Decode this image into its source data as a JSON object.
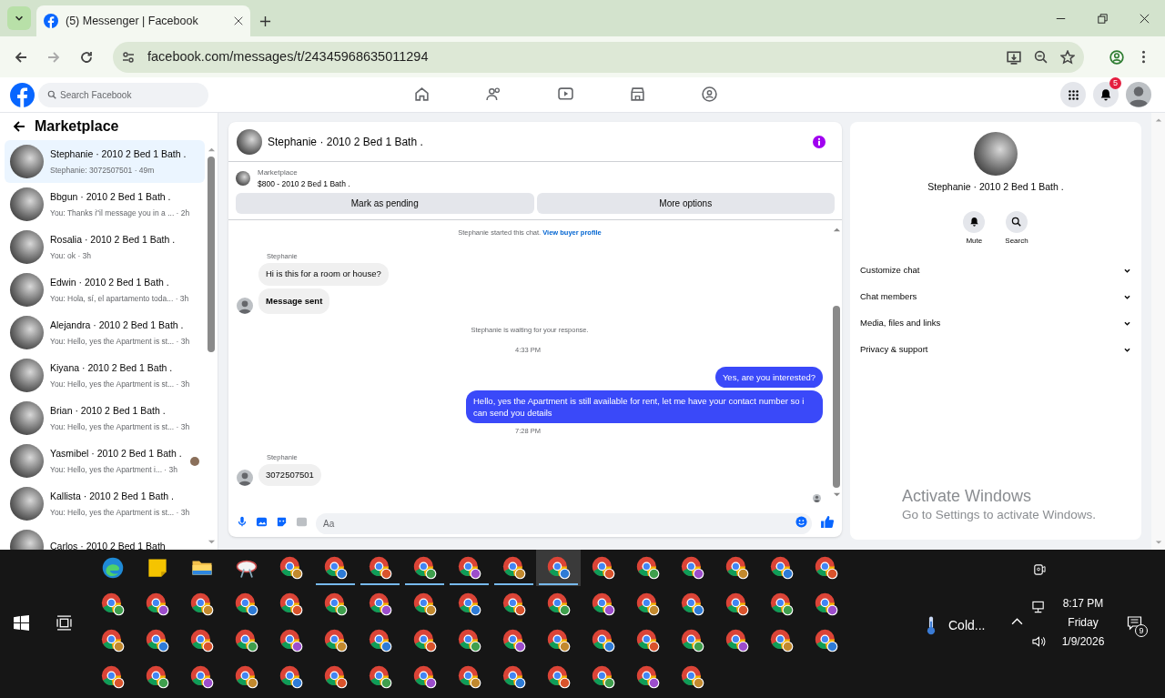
{
  "browser": {
    "tab": {
      "title": "(5) Messenger | Facebook",
      "selected": true
    },
    "url": "facebook.com/messages/t/24345968635011294"
  },
  "facebook": {
    "search": {
      "placeholder": "Search Facebook"
    },
    "nav": [
      {
        "kind": "home",
        "selected": false
      },
      {
        "kind": "friends",
        "selected": false
      },
      {
        "kind": "video",
        "selected": false
      },
      {
        "kind": "marketplace",
        "selected": false
      },
      {
        "kind": "groups",
        "selected": false
      }
    ],
    "notification_count": "5"
  },
  "sidebar": {
    "title": "Marketplace",
    "conversations": [
      {
        "title": "Stephanie · 2010 2 Bed 1 Bath .",
        "preview": "Stephanie: 3072507501 · 49m",
        "selected": true,
        "seen": false
      },
      {
        "title": "Bbgun · 2010 2 Bed 1 Bath .",
        "preview": "You: Thanks i\"il message you in a ... · 2h",
        "selected": false,
        "seen": false
      },
      {
        "title": "Rosalia · 2010 2 Bed 1 Bath .",
        "preview": "You: ok · 3h",
        "selected": false,
        "seen": false
      },
      {
        "title": "Edwin · 2010 2 Bed 1 Bath .",
        "preview": "You: Hola, sí, el apartamento toda... · 3h",
        "selected": false,
        "seen": false
      },
      {
        "title": "Alejandra · 2010 2 Bed 1 Bath .",
        "preview": "You: Hello, yes the Apartment is st... · 3h",
        "selected": false,
        "seen": false
      },
      {
        "title": "Kiyana · 2010 2 Bed 1 Bath .",
        "preview": "You: Hello, yes the Apartment is st... · 3h",
        "selected": false,
        "seen": false
      },
      {
        "title": "Brian · 2010 2 Bed 1 Bath .",
        "preview": "You: Hello, yes the Apartment is st... · 3h",
        "selected": false,
        "seen": false
      },
      {
        "title": "Yasmibel · 2010 2 Bed 1 Bath .",
        "preview": "You: Hello, yes the Apartment i... · 3h",
        "selected": false,
        "seen": true
      },
      {
        "title": "Kallista · 2010 2 Bed 1 Bath .",
        "preview": "You: Hello, yes the Apartment is st... · 3h",
        "selected": false,
        "seen": false
      },
      {
        "title": "Carlos · 2010 2 Bed 1 Bath",
        "selected": false,
        "seen": false
      }
    ]
  },
  "chat": {
    "title": "Stephanie · 2010 2 Bed 1 Bath .",
    "listing": {
      "label": "Marketplace",
      "title": "$800 - 2010 2 Bed 1 Bath ."
    },
    "buttons": [
      "Mark as pending",
      "More options"
    ],
    "messages": [
      {
        "kind": "notice",
        "text": "Stephanie started this chat.",
        "link": "View buyer profile"
      },
      {
        "kind": "sender",
        "text": "Stephanie"
      },
      {
        "kind": "incoming",
        "text": "Hi is this for a room or house?",
        "avatar": false,
        "bold": false
      },
      {
        "kind": "incoming",
        "text": "Message sent",
        "avatar": true,
        "bold": true
      },
      {
        "kind": "notice",
        "text": "Stephanie is waiting for your response."
      },
      {
        "kind": "time",
        "text": "4:33 PM"
      },
      {
        "kind": "outgoing",
        "text": "Yes, are you interested?"
      },
      {
        "kind": "outgoing",
        "text": "Hello, yes the Apartment is still available for rent, let me have your contact number so i can send you details"
      },
      {
        "kind": "time",
        "text": "7:28 PM"
      },
      {
        "kind": "sender",
        "text": "Stephanie"
      },
      {
        "kind": "incoming",
        "text": "3072507501",
        "avatar": true,
        "bold": false
      }
    ],
    "composer": {
      "placeholder": "Aa"
    }
  },
  "details": {
    "title": "Stephanie · 2010 2 Bed 1 Bath .",
    "actions": [
      {
        "kind": "bell",
        "label": "Mute"
      },
      {
        "kind": "search",
        "label": "Search"
      }
    ],
    "sections": [
      {
        "label": "Customize chat",
        "expanded": false
      },
      {
        "label": "Chat members",
        "expanded": false
      },
      {
        "label": "Media, files and links",
        "expanded": false
      },
      {
        "label": "Privacy & support",
        "expanded": false
      }
    ]
  },
  "activation_notice": {
    "title": "Activate Windows",
    "text": "Go to Settings to activate Windows."
  },
  "taskbar": {
    "apps": [
      {
        "kind": "edge",
        "running": false,
        "active": false
      },
      {
        "kind": "notes",
        "running": false,
        "active": false
      },
      {
        "kind": "folder",
        "running": false,
        "active": false
      },
      {
        "kind": "snip",
        "running": false,
        "active": false
      },
      {
        "kind": "browser",
        "running": false,
        "active": false
      },
      {
        "kind": "browser",
        "running": true,
        "active": false
      },
      {
        "kind": "browser",
        "running": true,
        "active": false
      },
      {
        "kind": "browser",
        "running": true,
        "active": false
      },
      {
        "kind": "browser",
        "running": true,
        "active": false
      },
      {
        "kind": "browser",
        "running": true,
        "active": false
      },
      {
        "kind": "browser",
        "running": true,
        "active": true
      },
      {
        "kind": "browser",
        "running": false,
        "active": false
      },
      {
        "kind": "browser",
        "running": false,
        "active": false
      },
      {
        "kind": "browser",
        "running": false,
        "active": false
      },
      {
        "kind": "browser",
        "running": false,
        "active": false
      },
      {
        "kind": "browser",
        "running": false,
        "active": false
      },
      {
        "kind": "browser",
        "running": false,
        "active": false
      },
      {
        "kind": "browser",
        "running": false,
        "active": false
      },
      {
        "kind": "browser",
        "running": false,
        "active": false
      },
      {
        "kind": "browser",
        "running": false,
        "active": false
      },
      {
        "kind": "browser",
        "running": false,
        "active": false
      },
      {
        "kind": "browser",
        "running": false,
        "active": false
      },
      {
        "kind": "browser",
        "running": false,
        "active": false
      },
      {
        "kind": "browser",
        "running": false,
        "active": false
      },
      {
        "kind": "browser",
        "running": false,
        "active": false
      },
      {
        "kind": "browser",
        "running": false,
        "active": false
      },
      {
        "kind": "browser",
        "running": false,
        "active": false
      },
      {
        "kind": "browser",
        "running": false,
        "active": false
      },
      {
        "kind": "browser",
        "running": false,
        "active": false
      },
      {
        "kind": "browser",
        "running": false,
        "active": false
      },
      {
        "kind": "browser",
        "running": false,
        "active": false
      },
      {
        "kind": "browser",
        "running": false,
        "active": false
      },
      {
        "kind": "browser",
        "running": false,
        "active": false
      },
      {
        "kind": "browser",
        "running": false,
        "active": false
      },
      {
        "kind": "browser",
        "running": false,
        "active": false
      },
      {
        "kind": "browser",
        "running": false,
        "active": false
      },
      {
        "kind": "browser",
        "running": false,
        "active": false
      },
      {
        "kind": "browser",
        "running": false,
        "active": false
      },
      {
        "kind": "browser",
        "running": false,
        "active": false
      },
      {
        "kind": "browser",
        "running": false,
        "active": false
      },
      {
        "kind": "browser",
        "running": false,
        "active": false
      },
      {
        "kind": "browser",
        "running": false,
        "active": false
      },
      {
        "kind": "browser",
        "running": false,
        "active": false
      },
      {
        "kind": "browser",
        "running": false,
        "active": false
      },
      {
        "kind": "browser",
        "running": false,
        "active": false
      },
      {
        "kind": "browser",
        "running": false,
        "active": false
      },
      {
        "kind": "browser",
        "running": false,
        "active": false
      },
      {
        "kind": "browser",
        "running": false,
        "active": false
      },
      {
        "kind": "browser",
        "running": false,
        "active": false
      },
      {
        "kind": "browser",
        "running": false,
        "active": false
      },
      {
        "kind": "browser",
        "running": false,
        "active": false
      },
      {
        "kind": "browser",
        "running": false,
        "active": false
      },
      {
        "kind": "browser",
        "running": false,
        "active": false
      },
      {
        "kind": "browser",
        "running": false,
        "active": false
      },
      {
        "kind": "browser",
        "running": false,
        "active": false
      },
      {
        "kind": "browser",
        "running": false,
        "active": false
      },
      {
        "kind": "browser",
        "running": false,
        "active": false
      },
      {
        "kind": "browser",
        "running": false,
        "active": false
      },
      {
        "kind": "browser",
        "running": false,
        "active": false
      },
      {
        "kind": "browser",
        "running": false,
        "active": false
      },
      {
        "kind": "browser",
        "running": false,
        "active": false
      },
      {
        "kind": "browser",
        "running": false,
        "active": false
      },
      {
        "kind": "browser",
        "running": false,
        "active": false
      },
      {
        "kind": "browser",
        "running": false,
        "active": false
      },
      {
        "kind": "browser",
        "running": false,
        "active": false
      }
    ],
    "weather": "Cold...",
    "time": "8:17 PM",
    "day": "Friday",
    "date": "1/9/2026",
    "notification_count": "9"
  }
}
